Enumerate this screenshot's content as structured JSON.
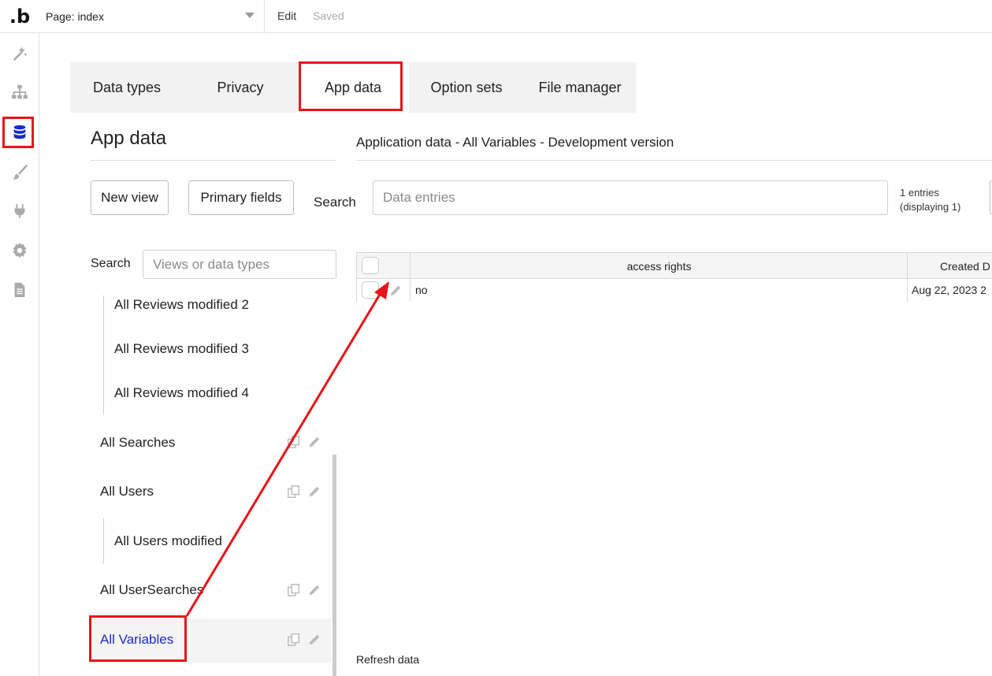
{
  "topbar": {
    "logo_text": ".b",
    "page_select": "Page: index",
    "edit": "Edit",
    "saved": "Saved"
  },
  "sidebar": {
    "icons": [
      "design-icon",
      "structure-icon",
      "database-icon",
      "style-icon",
      "plugin-icon",
      "settings-icon",
      "logs-icon"
    ],
    "active": "database-icon"
  },
  "tabs": [
    {
      "label": "Data types"
    },
    {
      "label": "Privacy"
    },
    {
      "label": "App data",
      "active": true
    },
    {
      "label": "Option sets"
    },
    {
      "label": "File manager"
    }
  ],
  "left_panel": {
    "title": "App data",
    "new_view": "New view",
    "primary_fields": "Primary fields",
    "search_label": "Search",
    "search_placeholder": "Views or data types",
    "views": [
      {
        "label": "All Reviews modified 2",
        "sub": true
      },
      {
        "label": "All Reviews modified 3",
        "sub": true
      },
      {
        "label": "All Reviews modified 4",
        "sub": true
      },
      {
        "label": "All Searches",
        "sub": false
      },
      {
        "label": "All Users",
        "sub": false
      },
      {
        "label": "All Users modified",
        "sub": true
      },
      {
        "label": "All UserSearches",
        "sub": false
      },
      {
        "label": "All Variables",
        "sub": false,
        "active": true
      }
    ]
  },
  "right_panel": {
    "header": "Application data - All Variables - Development version",
    "search_label": "Search",
    "search_placeholder": "Data entries",
    "entries_line1": "1 entries",
    "entries_line2": "(displaying 1)",
    "columns": [
      "access rights",
      "Created D"
    ],
    "rows": [
      {
        "access_rights": "no",
        "created": "Aug 22, 2023 2"
      }
    ],
    "refresh": "Refresh data"
  },
  "colors": {
    "highlight": "#e8141a",
    "active_link": "#1a2bc7",
    "db_icon": "#1a2bc7"
  }
}
